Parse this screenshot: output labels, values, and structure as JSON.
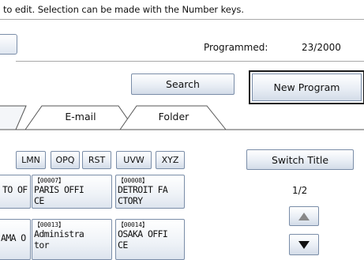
{
  "instruction": "to edit. Selection can be made with the Number keys.",
  "status": {
    "programmed_label": "Programmed:",
    "programmed_count": "23/2000"
  },
  "buttons": {
    "search": "Search",
    "new_program": "New Program",
    "switch_title": "Switch Title"
  },
  "tabs": [
    {
      "label": "E-mail"
    },
    {
      "label": "Folder"
    }
  ],
  "index_keys": [
    "LMN",
    "OPQ",
    "RST",
    "UVW",
    "XYZ"
  ],
  "entries": [
    {
      "number": "",
      "name_line1": "TO OF",
      "name_line2": ""
    },
    {
      "number": "【00007】",
      "name_line1": "PARIS OFFI",
      "name_line2": "CE"
    },
    {
      "number": "【00008】",
      "name_line1": "DETROIT FA",
      "name_line2": "CTORY"
    },
    {
      "number": "",
      "name_line1": "AMA O",
      "name_line2": ""
    },
    {
      "number": "【00013】",
      "name_line1": "Administra",
      "name_line2": "tor"
    },
    {
      "number": "【00014】",
      "name_line1": "OSAKA OFFI",
      "name_line2": "CE"
    }
  ],
  "pagination": {
    "page": "1/2"
  },
  "icons": {
    "up": "up-triangle-icon",
    "down": "down-triangle-icon"
  }
}
